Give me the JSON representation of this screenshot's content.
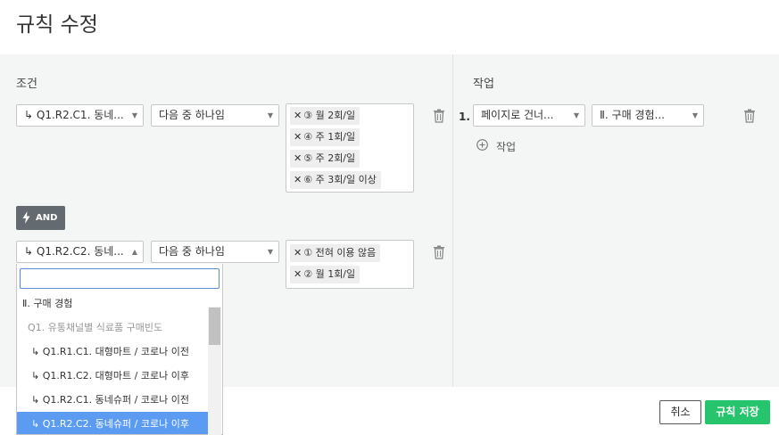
{
  "dialog": {
    "title": "규칙 수정"
  },
  "conditions": {
    "label": "조건",
    "rows": [
      {
        "question": "↳ Q1.R2.C1. 동네...",
        "operator": "다음 중 하나임",
        "values": [
          "③ 월 2회/일",
          "④ 주 1회/일",
          "⑤ 주 2회/일",
          "⑥ 주 3회/일 이상"
        ]
      },
      {
        "question": "↳ Q1.R2.C2. 동네...",
        "operator": "다음 중 하나임",
        "values": [
          "① 전혀 이용 않음",
          "② 월 1회/일"
        ]
      }
    ],
    "connector": "AND"
  },
  "actions": {
    "label": "작업",
    "rows": [
      {
        "number": "1.",
        "action": "페이지로 건너...",
        "target": "Ⅱ. 구매 경험..."
      }
    ],
    "add_label": "작업"
  },
  "dropdown": {
    "search_value": "",
    "items": [
      {
        "label": "Ⅱ. 구매 경험",
        "kind": "group"
      },
      {
        "label": "Q1. 유통채널별 식료품 구매빈도",
        "kind": "sub"
      },
      {
        "label": "↳ Q1.R1.C1. 대형마트 / 코로나 이전",
        "kind": "opt"
      },
      {
        "label": "↳ Q1.R1.C2. 대형마트 / 코로나 이후",
        "kind": "opt"
      },
      {
        "label": "↳ Q1.R2.C1. 동네슈퍼 / 코로나 이전",
        "kind": "opt"
      },
      {
        "label": "↳ Q1.R2.C2. 동네슈퍼 / 코로나 이후",
        "kind": "active"
      }
    ]
  },
  "footer": {
    "cancel_label": "취소",
    "save_label": "규칙 저장"
  },
  "colors": {
    "accent_green": "#27c46e",
    "selected_blue": "#5b9cf2",
    "and_button": "#646b70"
  }
}
